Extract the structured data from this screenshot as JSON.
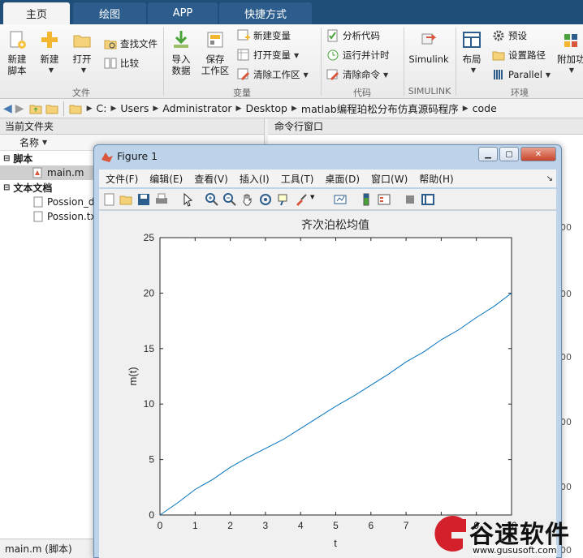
{
  "tabs": [
    {
      "label": "主页",
      "active": true
    },
    {
      "label": "绘图",
      "active": false
    },
    {
      "label": "APP",
      "active": false
    },
    {
      "label": "快捷方式",
      "active": false
    }
  ],
  "ribbon": {
    "file": {
      "new_script": "新建\n脚本",
      "new": "新建",
      "open": "打开",
      "find_files": "查找文件",
      "compare": "比较",
      "group": "文件"
    },
    "variable": {
      "import": "导入\n数据",
      "save_workspace": "保存\n工作区",
      "new_variable": "新建变量",
      "open_variable": "打开变量",
      "clear_workspace": "清除工作区",
      "group": "变量"
    },
    "code": {
      "analyze": "分析代码",
      "run_time": "运行并计时",
      "clear_commands": "清除命令",
      "group": "代码"
    },
    "simulink": {
      "label": "Simulink",
      "group": "SIMULINK"
    },
    "env": {
      "layout": "布局",
      "preferences": "预设",
      "set_path": "设置路径",
      "parallel": "Parallel",
      "addons": "附加功",
      "group": "环境"
    }
  },
  "address": [
    "C:",
    "Users",
    "Administrator",
    "Desktop",
    "matlab编程珀松分布仿真源码程序",
    "code"
  ],
  "current_folder": {
    "title": "当前文件夹",
    "col_name": "名称",
    "groups": [
      {
        "label": "脚本",
        "items": [
          "main.m"
        ]
      },
      {
        "label": "文本文档",
        "items": [
          "Possion_d",
          "Possion.tx"
        ]
      }
    ],
    "status": "main.m  (脚本)"
  },
  "command_window": {
    "title": "命令行窗口",
    "right_values": [
      "00",
      "00",
      "00",
      "00",
      "00",
      "00"
    ]
  },
  "figure": {
    "title": "Figure 1",
    "menus": [
      "文件(F)",
      "编辑(E)",
      "查看(V)",
      "插入(I)",
      "工具(T)",
      "桌面(D)",
      "窗口(W)",
      "帮助(H)"
    ]
  },
  "chart_data": {
    "type": "line",
    "title": "齐次泊松均值",
    "xlabel": "t",
    "ylabel": "m(t)",
    "xlim": [
      0,
      10
    ],
    "ylim": [
      0,
      25
    ],
    "xticks": [
      0,
      1,
      2,
      3,
      4,
      5,
      6,
      7,
      8,
      9,
      10
    ],
    "yticks": [
      0,
      5,
      10,
      15,
      20,
      25
    ],
    "grid": false,
    "color": "#0072bd",
    "x": [
      0,
      0.5,
      1,
      1.5,
      2,
      2.5,
      3,
      3.5,
      4,
      4.5,
      5,
      5.5,
      6,
      6.5,
      7,
      7.5,
      8,
      8.5,
      9,
      9.5,
      10
    ],
    "y": [
      0,
      1.1,
      2.3,
      3.2,
      4.3,
      5.2,
      6.0,
      6.8,
      7.8,
      8.8,
      9.8,
      10.7,
      11.7,
      12.7,
      13.8,
      14.7,
      15.8,
      16.7,
      17.8,
      18.8,
      20.0
    ]
  },
  "watermark": {
    "text": "谷速软件",
    "url": "www.gususoft.com"
  }
}
